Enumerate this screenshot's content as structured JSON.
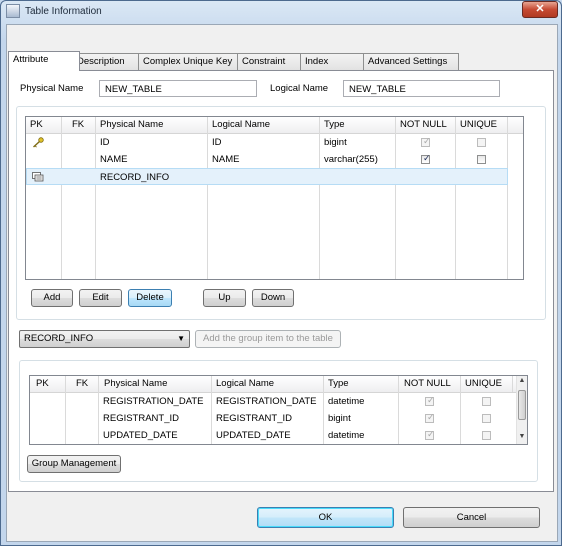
{
  "window": {
    "title": "Table Information",
    "close_glyph": "✕"
  },
  "tabs": [
    "Attribute",
    "Description",
    "Complex Unique Key",
    "Constraint",
    "Index",
    "Advanced Settings"
  ],
  "physical_name": {
    "label": "Physical Name",
    "value": "NEW_TABLE"
  },
  "logical_name": {
    "label": "Logical Name",
    "value": "NEW_TABLE"
  },
  "columns": [
    "PK",
    "FK",
    "Physical Name",
    "Logical Name",
    "Type",
    "NOT NULL",
    "UNIQUE"
  ],
  "attributes": [
    {
      "icon": "primary-key-icon",
      "physical": "ID",
      "logical": "ID",
      "type": "bigint",
      "not_null": true,
      "not_null_enabled": false,
      "unique": false,
      "unique_enabled": false
    },
    {
      "icon": "",
      "physical": "NAME",
      "logical": "NAME",
      "type": "varchar(255)",
      "not_null": true,
      "not_null_enabled": true,
      "unique": false,
      "unique_enabled": true
    },
    {
      "icon": "group-icon",
      "physical": "RECORD_INFO",
      "logical": "",
      "type": "",
      "selected": true
    }
  ],
  "buttons": {
    "add": "Add",
    "edit": "Edit",
    "delete": "Delete",
    "up": "Up",
    "down": "Down"
  },
  "group_combo": {
    "value": "RECORD_INFO",
    "arrow": "▼"
  },
  "add_group_button": "Add the group item to the table",
  "group_columns": [
    "PK",
    "FK",
    "Physical Name",
    "Logical Name",
    "Type",
    "NOT NULL",
    "UNIQUE"
  ],
  "group_items": [
    {
      "physical": "REGISTRATION_DATE",
      "logical": "REGISTRATION_DATE",
      "type": "datetime"
    },
    {
      "physical": "REGISTRANT_ID",
      "logical": "REGISTRANT_ID",
      "type": "bigint"
    },
    {
      "physical": "UPDATED_DATE",
      "logical": "UPDATED_DATE",
      "type": "datetime"
    }
  ],
  "group_management_button": "Group Management",
  "ok_button": "OK",
  "cancel_button": "Cancel",
  "colors": {
    "selection": "#e4f1fb",
    "titlebar": "#c3d6ec",
    "close": "#c64a33"
  }
}
